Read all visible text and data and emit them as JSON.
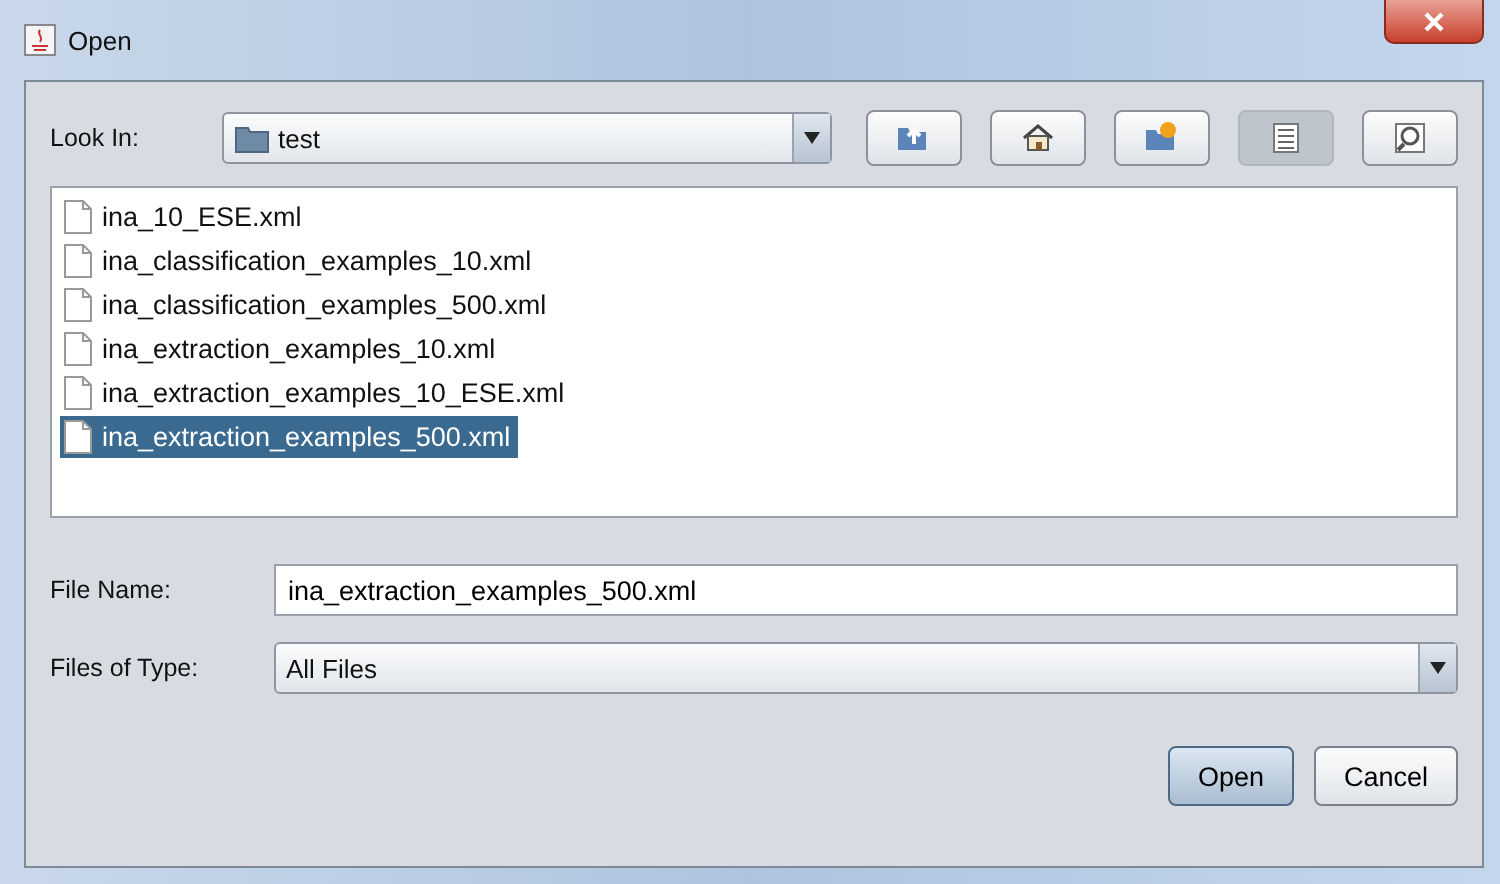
{
  "window": {
    "title": "Open"
  },
  "look_in": {
    "label": "Look In:",
    "value": "test"
  },
  "toolbar_buttons": [
    {
      "kind": "up",
      "selected": false
    },
    {
      "kind": "home",
      "selected": false
    },
    {
      "kind": "new_folder",
      "selected": false
    },
    {
      "kind": "list",
      "selected": true
    },
    {
      "kind": "details",
      "selected": false
    }
  ],
  "files": [
    {
      "name": "ina_10_ESE.xml",
      "selected": false
    },
    {
      "name": "ina_classification_examples_10.xml",
      "selected": false
    },
    {
      "name": "ina_classification_examples_500.xml",
      "selected": false
    },
    {
      "name": "ina_extraction_examples_10.xml",
      "selected": false
    },
    {
      "name": "ina_extraction_examples_10_ESE.xml",
      "selected": false
    },
    {
      "name": "ina_extraction_examples_500.xml",
      "selected": true
    }
  ],
  "file_name": {
    "label": "File Name:",
    "value": "ina_extraction_examples_500.xml"
  },
  "files_of_type": {
    "label": "Files of Type:",
    "value": "All Files"
  },
  "buttons": [
    {
      "label": "Open",
      "kind": "default"
    },
    {
      "label": "Cancel",
      "kind": "normal"
    }
  ]
}
